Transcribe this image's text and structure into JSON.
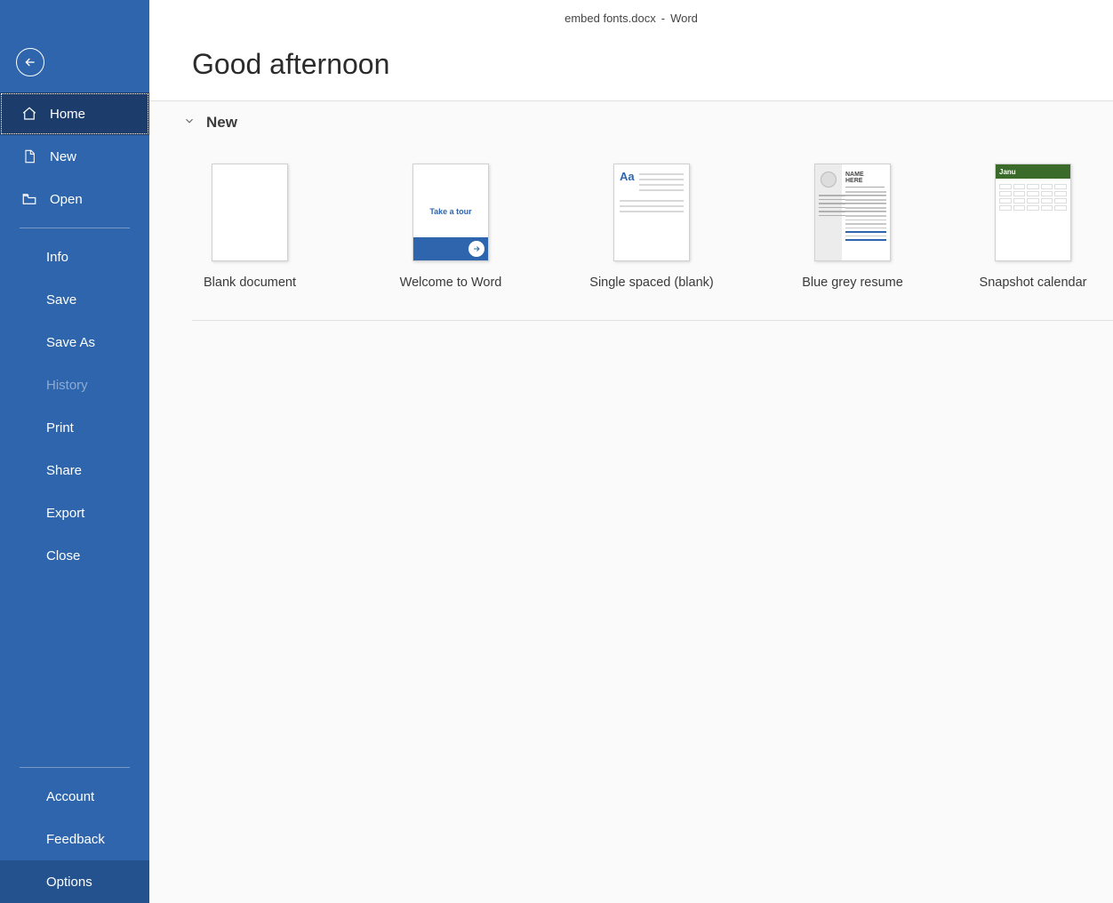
{
  "titlebar": {
    "document": "embed fonts.docx",
    "separator": "-",
    "app": "Word"
  },
  "sidebar": {
    "primary": [
      {
        "id": "home",
        "label": "Home",
        "icon": "home-icon",
        "selected": true
      },
      {
        "id": "new",
        "label": "New",
        "icon": "document-icon",
        "selected": false
      },
      {
        "id": "open",
        "label": "Open",
        "icon": "folder-open-icon",
        "selected": false
      }
    ],
    "secondary": [
      {
        "id": "info",
        "label": "Info",
        "disabled": false
      },
      {
        "id": "save",
        "label": "Save",
        "disabled": false
      },
      {
        "id": "saveas",
        "label": "Save As",
        "disabled": false
      },
      {
        "id": "history",
        "label": "History",
        "disabled": true
      },
      {
        "id": "print",
        "label": "Print",
        "disabled": false
      },
      {
        "id": "share",
        "label": "Share",
        "disabled": false
      },
      {
        "id": "export",
        "label": "Export",
        "disabled": false
      },
      {
        "id": "close",
        "label": "Close",
        "disabled": false
      }
    ],
    "bottom": [
      {
        "id": "account",
        "label": "Account",
        "active": false
      },
      {
        "id": "feedback",
        "label": "Feedback",
        "active": false
      },
      {
        "id": "options",
        "label": "Options",
        "active": true
      }
    ]
  },
  "main": {
    "greeting": "Good afternoon",
    "section_new": "New",
    "templates": [
      {
        "id": "blank",
        "label": "Blank document"
      },
      {
        "id": "welcome",
        "label": "Welcome to Word",
        "tour_text": "Take a tour"
      },
      {
        "id": "single",
        "label": "Single spaced (blank)",
        "aa": "Aa"
      },
      {
        "id": "resume",
        "label": "Blue grey resume",
        "name1": "NAME",
        "name2": "HERE"
      },
      {
        "id": "snapshot",
        "label": "Snapshot calendar",
        "cal_head": "Janu"
      }
    ]
  }
}
